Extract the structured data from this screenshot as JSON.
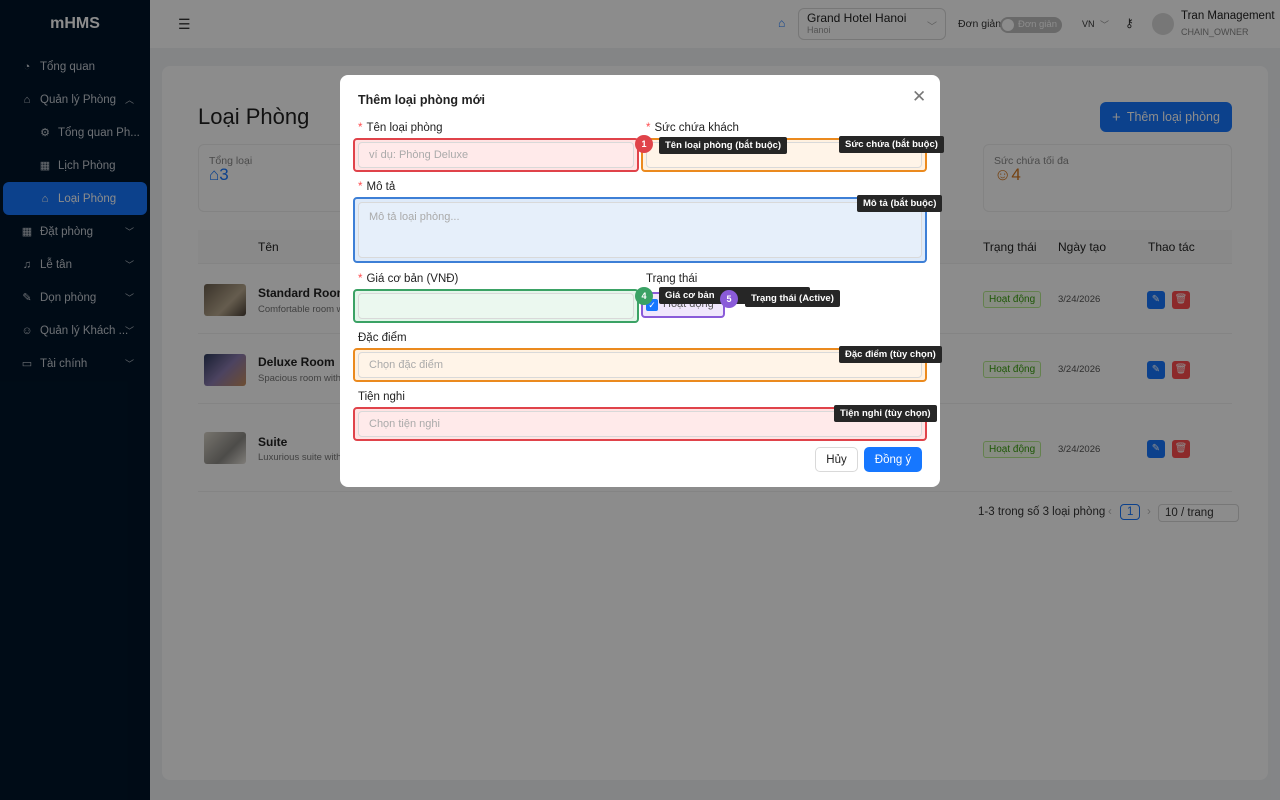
{
  "app": {
    "logo": "mHMS"
  },
  "sidebar": {
    "items": [
      {
        "label": "Tổng quan"
      },
      {
        "label": "Quản lý Phòng"
      },
      {
        "label": "Tổng quan Ph..."
      },
      {
        "label": "Lịch Phòng"
      },
      {
        "label": "Loại Phòng"
      },
      {
        "label": "Đặt phòng"
      },
      {
        "label": "Lễ tân"
      },
      {
        "label": "Dọn phòng"
      },
      {
        "label": "Quản lý Khách ..."
      },
      {
        "label": "Tài chính"
      }
    ]
  },
  "header": {
    "hotel_name": "Grand Hotel Hanoi",
    "hotel_city": "Hanoi",
    "simple_label": "Đơn giản",
    "toggle_text": "Đơn giản",
    "lang": "VN",
    "user_name": "Tran Management",
    "user_role": "CHAIN_OWNER"
  },
  "page": {
    "title": "Loại Phòng",
    "add_button": "Thêm loại phòng",
    "stat_total_label": "Tổng loại",
    "stat_total_value": "3",
    "stat_capacity_label": "Sức chứa tối đa",
    "stat_capacity_value": "4"
  },
  "table": {
    "columns": {
      "name": "Tên",
      "status": "Trạng thái",
      "created": "Ngày tạo",
      "actions": "Thao tác"
    },
    "rows": [
      {
        "name": "Standard Room",
        "desc": "Comfortable room w",
        "status": "Hoạt động",
        "date": "3/24/2026"
      },
      {
        "name": "Deluxe Room",
        "desc": "Spacious room with",
        "status": "Hoạt động",
        "date": "3/24/2026"
      },
      {
        "name": "Suite",
        "desc": "Luxurious suite with",
        "status": "Hoạt động",
        "date": "3/24/2026"
      }
    ],
    "pagination_text": "1-3 trong số 3 loại phòng",
    "current_page": "1",
    "page_size": "10 / trang"
  },
  "modal": {
    "title": "Thêm loại phòng mới",
    "name_label": "Tên loại phòng",
    "name_placeholder": "ví dụ: Phòng Deluxe",
    "capacity_label": "Sức chứa khách",
    "desc_label": "Mô tả",
    "desc_placeholder": "Mô tả loại phòng...",
    "price_label": "Giá cơ bản (VNĐ)",
    "status_label": "Trạng thái",
    "status_value": "Hoạt động",
    "features_label": "Đặc điểm",
    "features_placeholder": "Chọn đặc điểm",
    "amenities_label": "Tiện nghi",
    "amenities_placeholder": "Chọn tiện nghi",
    "cancel": "Hủy",
    "ok": "Đồng ý"
  },
  "annotations": {
    "badge1": "1",
    "badge4": "4",
    "badge5": "5",
    "tip_name": "Tên loại phòng (bắt buộc)",
    "tip_capacity": "Sức chứa (bắt buộc)",
    "tip_desc": "Mô tả (bắt buộc)",
    "tip_price": "Giá cơ bản",
    "tip_status": "Trạng thái (Active)",
    "tip_features": "Đặc điểm (tùy chọn)",
    "tip_amenities": "Tiện nghi (tùy chọn)"
  },
  "colors": {
    "primary": "#1677ff",
    "sidebar_bg": "#001529",
    "ann_red": "#e0434a",
    "ann_orange": "#eb8a1e",
    "ann_blue": "#3d7fd6",
    "ann_green": "#3ba265",
    "ann_purple": "#8a5bd9"
  }
}
